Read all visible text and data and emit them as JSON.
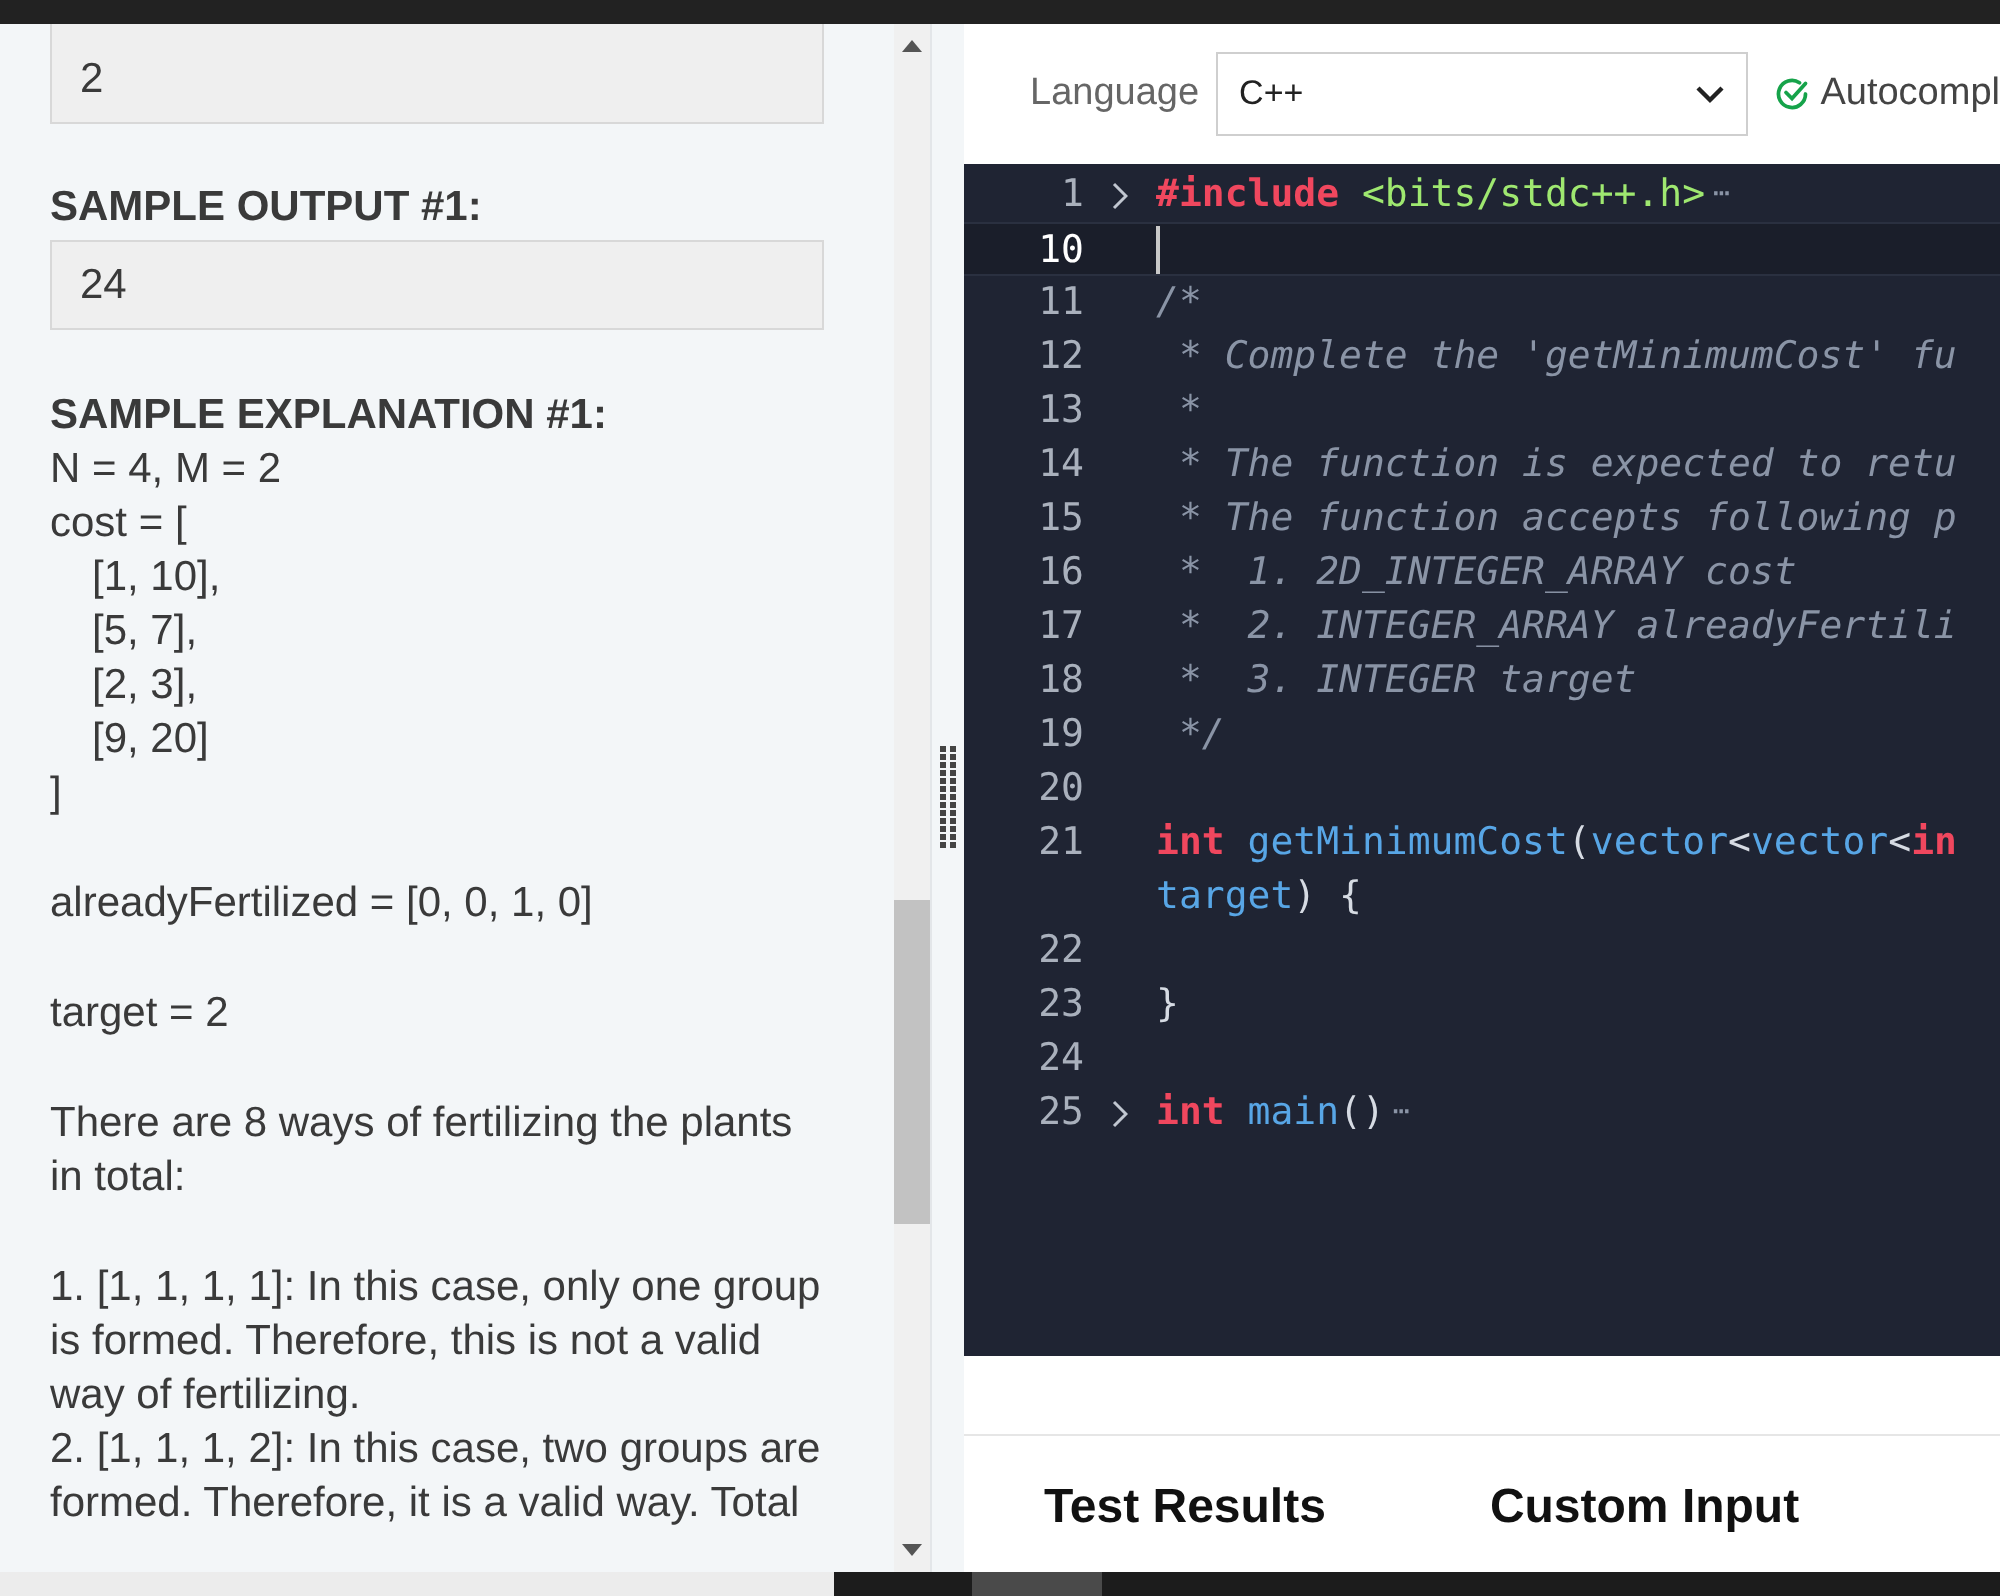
{
  "problem": {
    "input_box": [
      "2"
    ],
    "output_heading": "SAMPLE OUTPUT #1:",
    "output_box": [
      "24"
    ],
    "explanation_heading": "SAMPLE EXPLANATION #1:",
    "paragraphs": [
      {
        "lines": [
          {
            "text": "N = 4, M = 2",
            "indented": false
          },
          {
            "text": "cost = [",
            "indented": false
          },
          {
            "text": "[1, 10],",
            "indented": true
          },
          {
            "text": "[5, 7],",
            "indented": true
          },
          {
            "text": "[2, 3],",
            "indented": true
          },
          {
            "text": "[9, 20]",
            "indented": true
          },
          {
            "text": "]",
            "indented": false
          }
        ]
      },
      {
        "lines": [
          {
            "text": "alreadyFertilized = [0, 0, 1, 0]",
            "indented": false
          }
        ]
      },
      {
        "lines": [
          {
            "text": "target = 2",
            "indented": false
          }
        ]
      },
      {
        "lines": [
          {
            "text": "There are 8 ways of fertilizing the plants in total:",
            "indented": false
          }
        ]
      },
      {
        "lines": [
          {
            "text": "1. [1, 1, 1, 1]: In this case, only one group is formed. Therefore, this is not a valid way of fertilizing.",
            "indented": false
          },
          {
            "text": "2. [1, 1, 1, 2]: In this case, two groups are formed. Therefore, it is a valid way. Total",
            "indented": false
          }
        ]
      }
    ]
  },
  "toolbar": {
    "language_label": "Language",
    "language_value": "C++",
    "autocomplete": {
      "label": "Autocompl",
      "on": true
    }
  },
  "editor": {
    "lines": [
      {
        "number": "1",
        "folded": true,
        "fold_marker": "⋯",
        "current": false,
        "tokens": [
          {
            "kind": "keyword",
            "text": "#include "
          },
          {
            "kind": "string",
            "text": "<bits/stdc++.h>"
          }
        ]
      },
      {
        "number": "10",
        "folded": false,
        "current": true
      },
      {
        "number": "11",
        "folded": false,
        "current": false,
        "tokens": [
          {
            "kind": "comment",
            "text": "/*"
          }
        ]
      },
      {
        "number": "12",
        "folded": false,
        "current": false,
        "tokens": [
          {
            "kind": "comment",
            "text": " * Complete the 'getMinimumCost' fu"
          }
        ]
      },
      {
        "number": "13",
        "folded": false,
        "current": false,
        "tokens": [
          {
            "kind": "comment",
            "text": " *"
          }
        ]
      },
      {
        "number": "14",
        "folded": false,
        "current": false,
        "tokens": [
          {
            "kind": "comment",
            "text": " * The function is expected to retu"
          }
        ]
      },
      {
        "number": "15",
        "folded": false,
        "current": false,
        "tokens": [
          {
            "kind": "comment",
            "text": " * The function accepts following p"
          }
        ]
      },
      {
        "number": "16",
        "folded": false,
        "current": false,
        "tokens": [
          {
            "kind": "comment",
            "text": " *  1. 2D_INTEGER_ARRAY cost"
          }
        ]
      },
      {
        "number": "17",
        "folded": false,
        "current": false,
        "tokens": [
          {
            "kind": "comment",
            "text": " *  2. INTEGER_ARRAY alreadyFertili"
          }
        ]
      },
      {
        "number": "18",
        "folded": false,
        "current": false,
        "tokens": [
          {
            "kind": "comment",
            "text": " *  3. INTEGER target"
          }
        ]
      },
      {
        "number": "19",
        "folded": false,
        "current": false,
        "tokens": [
          {
            "kind": "comment",
            "text": " */"
          }
        ]
      },
      {
        "number": "20",
        "folded": false,
        "current": false
      },
      {
        "number": "21",
        "folded": false,
        "current": false,
        "tokens": [
          {
            "kind": "keyword",
            "text": "int "
          },
          {
            "kind": "name",
            "text": "getMinimumCost"
          },
          {
            "kind": "plain",
            "text": "("
          },
          {
            "kind": "name",
            "text": "vector"
          },
          {
            "kind": "plain",
            "text": "<"
          },
          {
            "kind": "name",
            "text": "vector"
          },
          {
            "kind": "plain",
            "text": "<"
          },
          {
            "kind": "keyword",
            "text": "in"
          }
        ]
      },
      {
        "folded": false,
        "current": false,
        "tokens": [
          {
            "kind": "name",
            "text": "target"
          },
          {
            "kind": "plain",
            "text": ") {"
          }
        ]
      },
      {
        "number": "22",
        "folded": false,
        "current": false
      },
      {
        "number": "23",
        "folded": false,
        "current": false,
        "tokens": [
          {
            "kind": "plain",
            "text": "}"
          }
        ]
      },
      {
        "number": "24",
        "folded": false,
        "current": false
      },
      {
        "number": "25",
        "folded": true,
        "fold_marker": "⋯",
        "current": false,
        "tokens": [
          {
            "kind": "keyword",
            "text": "int "
          },
          {
            "kind": "name",
            "text": "main"
          },
          {
            "kind": "plain",
            "text": "()"
          }
        ]
      }
    ]
  },
  "bottom_tabs": [
    "Test Results",
    "Custom Input"
  ]
}
